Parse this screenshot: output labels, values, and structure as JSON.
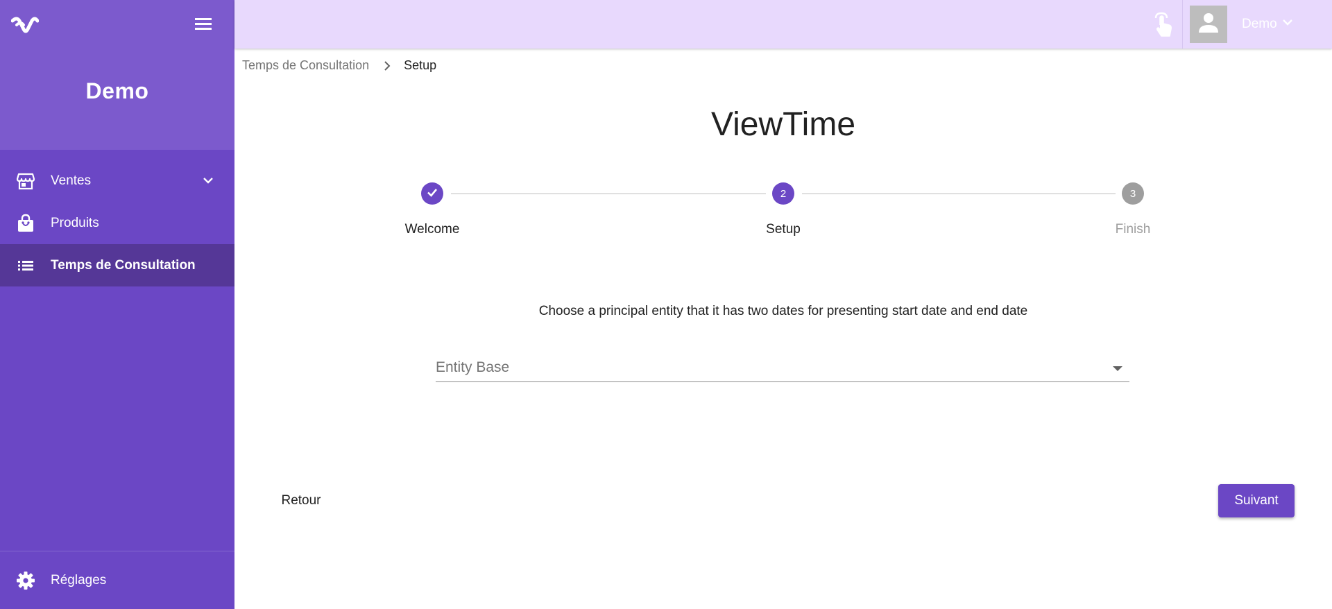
{
  "sidebar": {
    "workspace_name": "Demo",
    "items": [
      {
        "label": "Ventes",
        "icon": "store-icon",
        "active": false,
        "expandable": true
      },
      {
        "label": "Produits",
        "icon": "shopping-bag-icon",
        "active": false,
        "expandable": false
      },
      {
        "label": "Temps de Consultation",
        "icon": "list-icon",
        "active": true,
        "expandable": false
      }
    ],
    "settings_label": "Réglages"
  },
  "header": {
    "user_name": "Demo"
  },
  "breadcrumb": {
    "parent": "Temps de Consultation",
    "current": "Setup"
  },
  "main": {
    "title": "ViewTime",
    "steps": [
      {
        "label": "Welcome",
        "number": "",
        "state": "completed"
      },
      {
        "label": "Setup",
        "number": "2",
        "state": "active"
      },
      {
        "label": "Finish",
        "number": "3",
        "state": "inactive"
      }
    ],
    "instruction": "Choose a principal entity that it has two dates for presenting start date and end date",
    "select": {
      "placeholder": "Entity Base"
    },
    "back_label": "Retour",
    "next_label": "Suivant"
  },
  "colors": {
    "primary": "#6b47c5",
    "sidebar_header": "#7c5acd",
    "active_item": "#553797",
    "header_bg": "#e8d9fd",
    "inactive_step": "#9e9e9e"
  }
}
